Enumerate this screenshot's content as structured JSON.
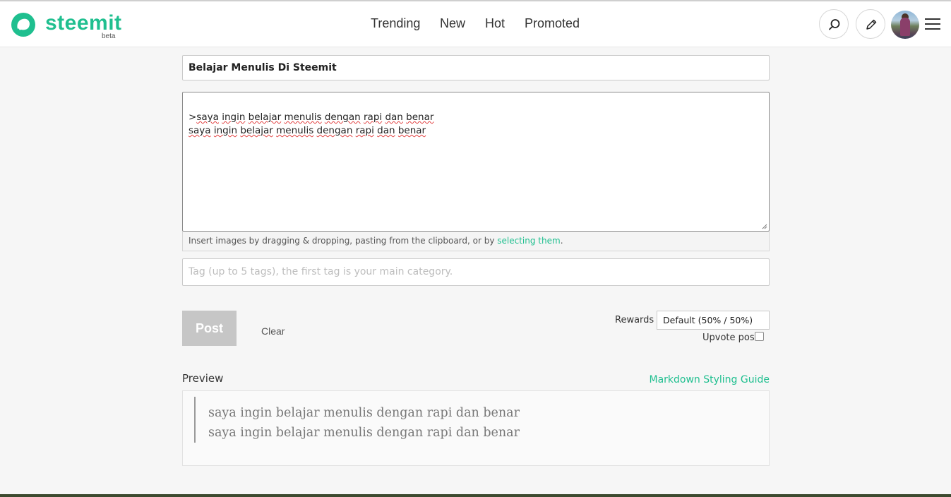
{
  "brand": {
    "name": "steemit",
    "badge": "beta",
    "color": "#1fbf8f"
  },
  "nav": {
    "items": [
      {
        "label": "Trending"
      },
      {
        "label": "New"
      },
      {
        "label": "Hot"
      },
      {
        "label": "Promoted"
      }
    ]
  },
  "header_icons": [
    "search-icon",
    "pencil-icon",
    "avatar",
    "hamburger-menu-icon"
  ],
  "editor": {
    "title_value": "Belajar Menulis Di Steemit",
    "body_lines": [
      ">saya ingin belajar menulis dengan rapi dan benar",
      "saya ingin belajar menulis dengan rapi dan benar"
    ],
    "hint_prefix": "Insert images by dragging & dropping, pasting from the clipboard, or by ",
    "hint_link": "selecting them",
    "hint_suffix": ".",
    "tags_placeholder": "Tag (up to 5 tags), the first tag is your main category."
  },
  "actions": {
    "post_label": "Post",
    "clear_label": "Clear",
    "rewards_label": "Rewards",
    "rewards_value": "Default (50% / 50%)",
    "upvote_label": "Upvote post",
    "upvote_checked": false
  },
  "preview": {
    "label": "Preview",
    "guide_link": "Markdown Styling Guide",
    "quote_lines": [
      "saya ingin belajar menulis dengan rapi dan benar",
      "saya ingin belajar menulis dengan rapi dan benar"
    ]
  }
}
